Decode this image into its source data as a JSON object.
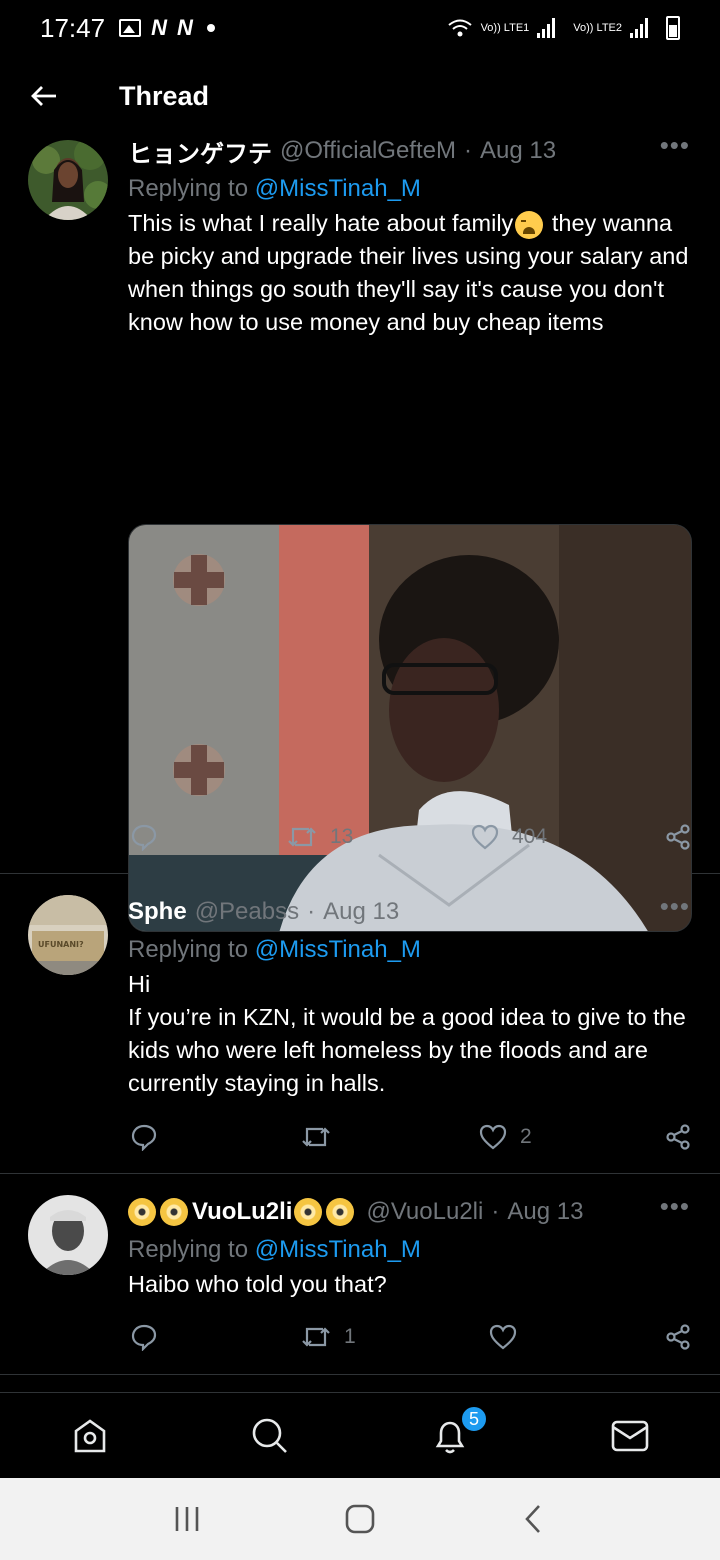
{
  "status_bar": {
    "time": "17:47",
    "sim1": "Vo)) LTE1",
    "sim2": "Vo)) LTE2"
  },
  "header": {
    "title": "Thread"
  },
  "tweets": [
    {
      "display_name": "ヒョンゲフテ",
      "handle": "@OfficialGefteM",
      "date": "Aug 13",
      "replying_prefix": "Replying to ",
      "replying_to": "@MissTinah_M",
      "text_part1": "This is what I really hate about family",
      "text_part2": " they wanna be picky and upgrade their lives using your salary and when things go south they'll say it's cause you don't know how to use money and buy cheap items",
      "retweets": "13",
      "likes": "404",
      "avatar_color": "#3e5a2c"
    },
    {
      "display_name": "Sphe",
      "handle": "@Peabss",
      "date": "Aug 13",
      "replying_prefix": "Replying to ",
      "replying_to": "@MissTinah_M",
      "text_line1": "Hi",
      "text_line2": "If you’re in KZN, it would be a good idea to give to the kids who were left homeless by the floods and are currently staying in halls.",
      "retweets": "",
      "likes": "2",
      "avatar_text": "UFUNANI?",
      "avatar_color": "#b9a47a"
    },
    {
      "display_name": "VuoLu2li",
      "handle": "@VuoLu2li",
      "date": "Aug 13",
      "replying_prefix": "Replying to ",
      "replying_to": "@MissTinah_M",
      "text": "Haibo who told you that?",
      "retweets": "1",
      "likes": "",
      "avatar_color": "#8a8a8a"
    }
  ],
  "separator": "·",
  "more_label": "•••",
  "bottom_nav": {
    "items": [
      "home-icon",
      "search-icon",
      "notifications-icon",
      "messages-icon"
    ],
    "notification_count": "5"
  },
  "colors": {
    "accent": "#1d9bf0",
    "background": "#000000",
    "muted": "#71767b"
  }
}
